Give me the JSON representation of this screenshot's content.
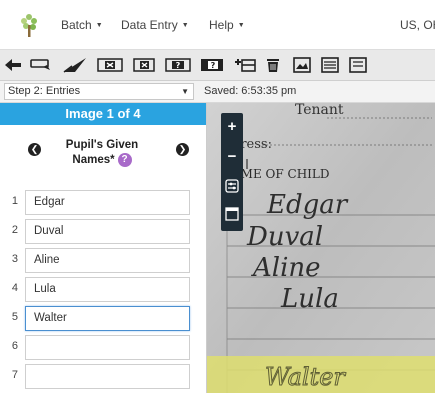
{
  "menubar": {
    "items": [
      {
        "label": "Batch"
      },
      {
        "label": "Data Entry"
      },
      {
        "label": "Help"
      }
    ],
    "region": "US, OH"
  },
  "stepbar": {
    "step": "Step 2: Entries",
    "saved": "Saved: 6:53:35 pm"
  },
  "panel": {
    "image_label": "Image 1 of 4",
    "field_title": "Pupil's Given Names*",
    "help_glyph": "?",
    "rows": [
      {
        "num": "1",
        "value": "Edgar"
      },
      {
        "num": "2",
        "value": "Duval"
      },
      {
        "num": "3",
        "value": "Aline"
      },
      {
        "num": "4",
        "value": "Lula"
      },
      {
        "num": "5",
        "value": "Walter"
      },
      {
        "num": "6",
        "value": ""
      },
      {
        "num": "7",
        "value": ""
      }
    ]
  },
  "image_text": {
    "tenant": "Tenant",
    "address": "dress:",
    "child_heading": "AME OF CHILD",
    "hand": [
      "Edgar",
      "Duval",
      "Aline",
      "Lula",
      "Walter"
    ]
  },
  "colors": {
    "accent": "#2aa3e0",
    "help": "#a86ac9",
    "toolstrip": "#1f2d37",
    "highlight": "#dede6f"
  }
}
